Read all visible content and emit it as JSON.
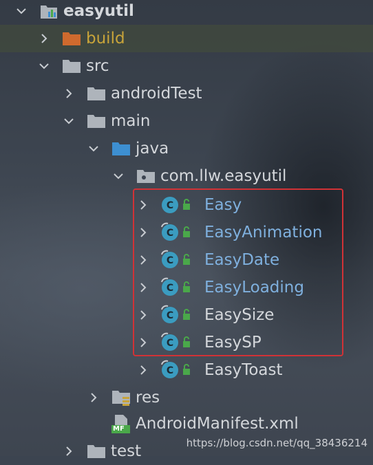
{
  "tree": {
    "root": {
      "label": "easyutil"
    },
    "build": {
      "label": "build"
    },
    "src": {
      "label": "src"
    },
    "androidTest": {
      "label": "androidTest"
    },
    "main": {
      "label": "main"
    },
    "java": {
      "label": "java"
    },
    "package": {
      "label": "com.llw.easyutil"
    },
    "classes": [
      {
        "label": "Easy"
      },
      {
        "label": "EasyAnimation"
      },
      {
        "label": "EasyDate"
      },
      {
        "label": "EasyLoading"
      },
      {
        "label": "EasySize"
      },
      {
        "label": "EasySP"
      },
      {
        "label": "EasyToast"
      }
    ],
    "res": {
      "label": "res"
    },
    "manifest": {
      "label": "AndroidManifest.xml",
      "badge": "MF"
    },
    "test": {
      "label": "test"
    }
  },
  "watermark": "https://blog.csdn.net/qq_38436214",
  "colors": {
    "selection_border": "#d23236",
    "class_link": "#7fb0de",
    "build_text": "#c8a43a",
    "folder": "#aeb4bb",
    "folder_build": "#cf6a2e",
    "folder_java": "#3d8fd1",
    "class_icon": "#3b9cc0",
    "lock": "#4aa84a"
  }
}
